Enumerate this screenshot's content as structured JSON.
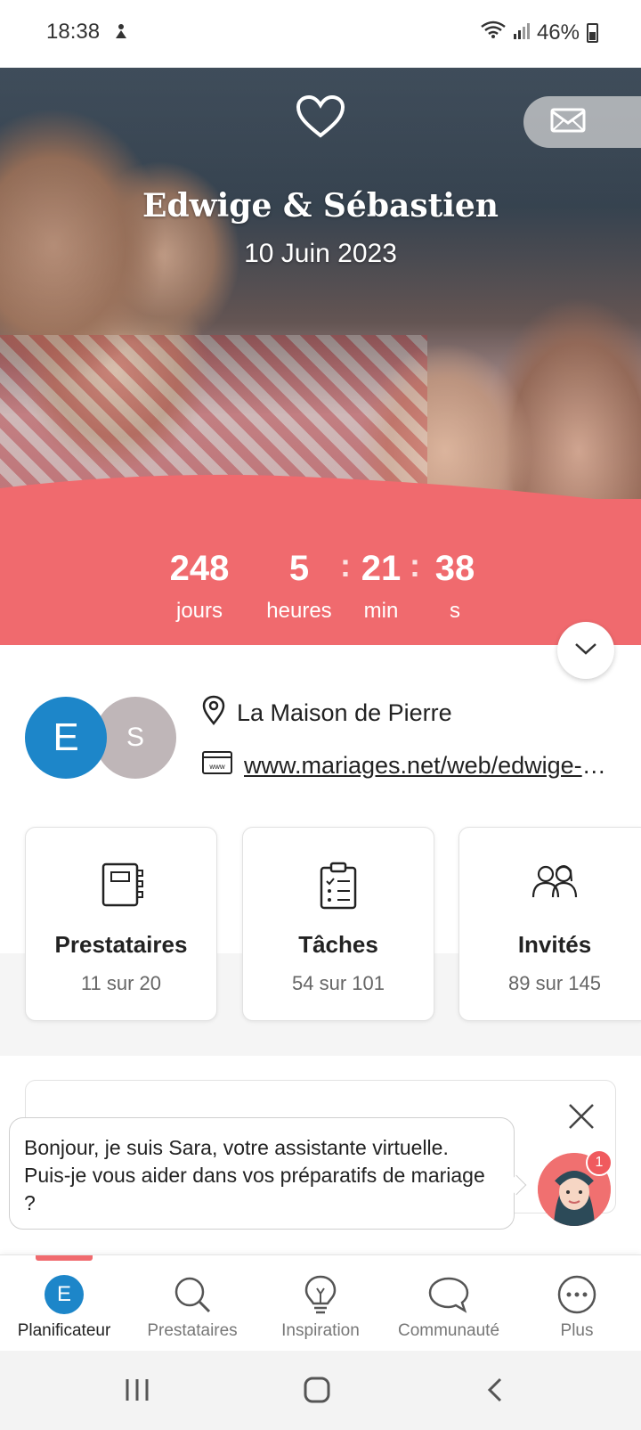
{
  "status_bar": {
    "time": "18:38",
    "battery": "46%"
  },
  "hero": {
    "title": "Edwige & Sébastien",
    "date": "10 Juin 2023"
  },
  "countdown": {
    "days": "248",
    "days_label": "jours",
    "hours": "5",
    "hours_label": "heures",
    "minutes": "21",
    "minutes_label": "min",
    "seconds": "38",
    "seconds_label": "s",
    "separator": ":"
  },
  "couple": {
    "initial_1": "E",
    "initial_2": "S",
    "venue": "La Maison de Pierre",
    "website": "www.mariages.net/web/edwige-et-sebastien"
  },
  "cards": [
    {
      "title": "Prestataires",
      "subtitle": "11 sur 20",
      "icon": "notebook-icon"
    },
    {
      "title": "Tâches",
      "subtitle": "54 sur 101",
      "icon": "checklist-icon"
    },
    {
      "title": "Invités",
      "subtitle": "89 sur 145",
      "icon": "guests-icon"
    }
  ],
  "assistant": {
    "message": "Bonjour, je suis Sara, votre assistante virtuelle. Puis-je vous aider dans vos préparatifs de mariage ?",
    "badge": "1"
  },
  "bottom_nav": {
    "items": [
      {
        "label": "Planificateur",
        "initial": "E",
        "active": true
      },
      {
        "label": "Prestataires",
        "icon": "search-icon"
      },
      {
        "label": "Inspiration",
        "icon": "lightbulb-icon"
      },
      {
        "label": "Communauté",
        "icon": "chat-bubble-icon"
      },
      {
        "label": "Plus",
        "icon": "more-icon"
      }
    ]
  },
  "colors": {
    "accent": "#f06a6e",
    "avatar_blue": "#1d86c9",
    "avatar_gray": "#bfb6b8"
  }
}
